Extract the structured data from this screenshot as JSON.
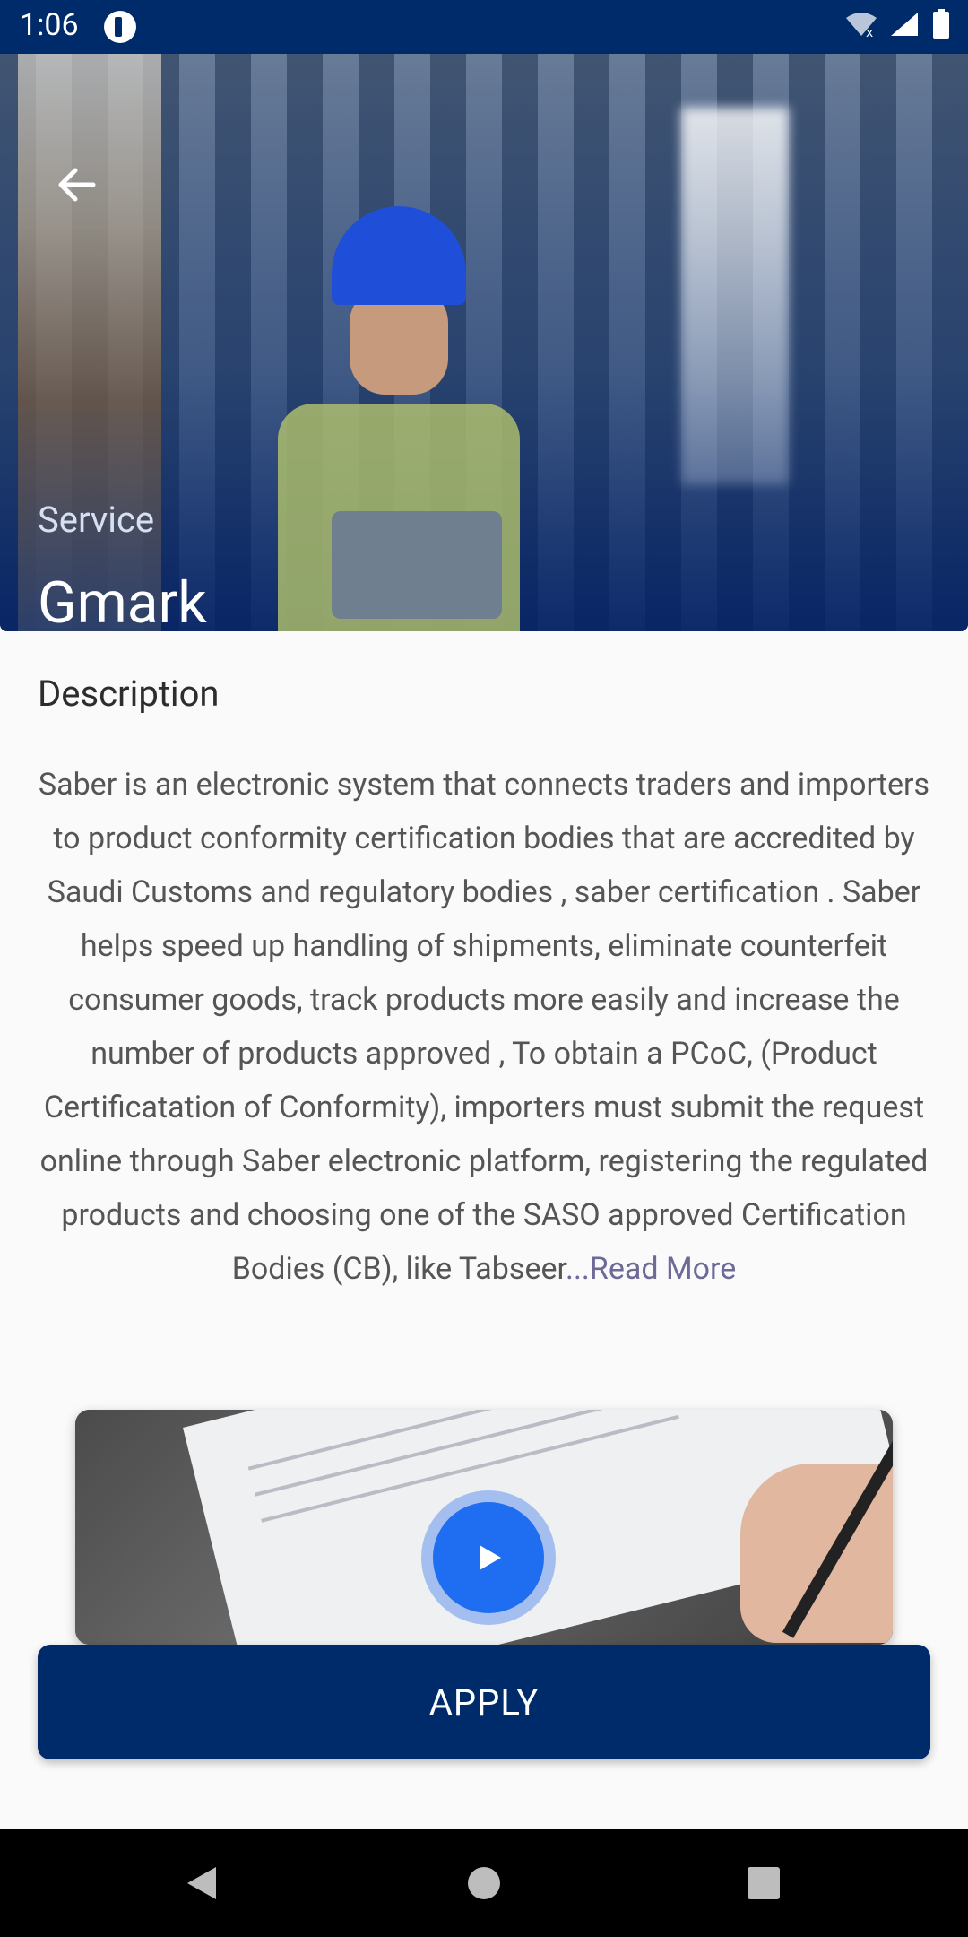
{
  "status_bar": {
    "time": "1:06"
  },
  "hero": {
    "subtitle": "Service",
    "title": "Gmark"
  },
  "description": {
    "heading": "Description",
    "text": "Saber is an electronic system that connects traders and importers to product conformity certification bodies that are accredited by Saudi Customs and regulatory bodies , saber certification . Saber helps speed up handling of shipments, eliminate counterfeit consumer goods, track products more easily and increase the number of products approved , To obtain a PCoC, (Product Certificatation of Conformity), importers must submit the request online through Saber electronic platform, registering the regulated products and choosing one of the SASO approved Certification Bodies (CB), like Tabseer",
    "read_more": "...Read More"
  },
  "video": {
    "play_icon": "play-icon"
  },
  "actions": {
    "apply_label": "APPLY"
  },
  "colors": {
    "primary": "#002b6b",
    "accent": "#1f6df0",
    "link": "#6e6a98"
  }
}
